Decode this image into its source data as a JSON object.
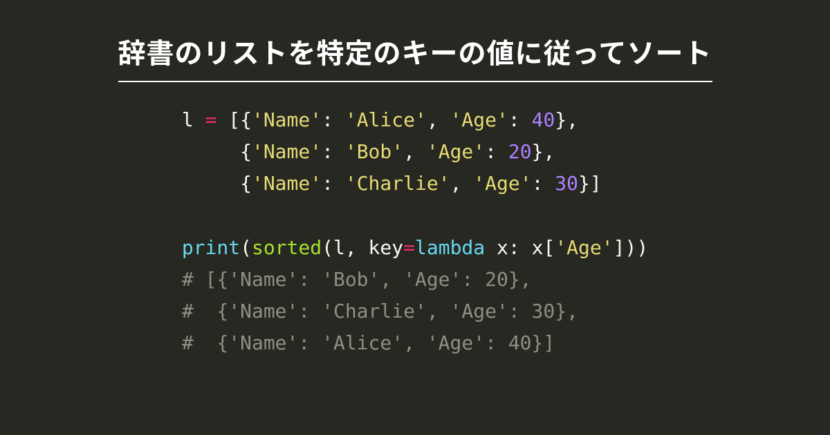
{
  "title": "辞書のリストを特定のキーの値に従ってソート",
  "code": {
    "l1": {
      "var": "l",
      "sp": " ",
      "op": "=",
      "sp2": " [{",
      "k1": "'Name'",
      "c1": ": ",
      "v1": "'Alice'",
      "cm1": ", ",
      "k2": "'Age'",
      "c2": ": ",
      "n1": "40",
      "end": "},"
    },
    "l2": {
      "pad": "     {",
      "k1": "'Name'",
      "c1": ": ",
      "v1": "'Bob'",
      "cm1": ", ",
      "k2": "'Age'",
      "c2": ": ",
      "n1": "20",
      "end": "},"
    },
    "l3": {
      "pad": "     {",
      "k1": "'Name'",
      "c1": ": ",
      "v1": "'Charlie'",
      "cm1": ", ",
      "k2": "'Age'",
      "c2": ": ",
      "n1": "30",
      "end": "}]"
    },
    "l4": "",
    "l5": {
      "fn": "print",
      "p1": "(",
      "b1": "sorted",
      "p2": "(l, key",
      "op": "=",
      "kw": "lambda",
      "sp": " x: x[",
      "s1": "'Age'",
      "end": "]))"
    },
    "l6": "# [{'Name': 'Bob', 'Age': 20},",
    "l7": "#  {'Name': 'Charlie', 'Age': 30},",
    "l8": "#  {'Name': 'Alice', 'Age': 40}]"
  }
}
